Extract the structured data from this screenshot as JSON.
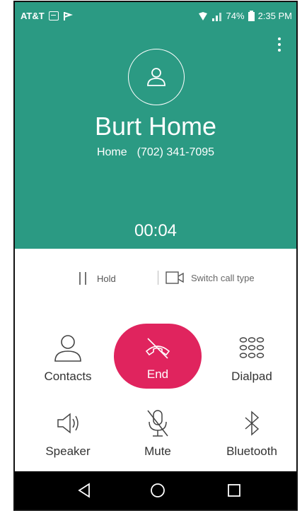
{
  "status_bar": {
    "carrier": "AT&T",
    "battery": "74%",
    "time": "2:35 PM"
  },
  "call": {
    "name": "Burt Home",
    "label": "Home",
    "number": "(702) 341-7095",
    "timer": "00:04"
  },
  "options": {
    "hold_label": "Hold",
    "switch_label": "Switch call type"
  },
  "buttons": {
    "contacts": "Contacts",
    "end": "End",
    "dialpad": "Dialpad",
    "speaker": "Speaker",
    "mute": "Mute",
    "bluetooth": "Bluetooth"
  },
  "colors": {
    "header": "#2b9a83",
    "end_button": "#e0245e",
    "navbar": "#000000"
  },
  "icons": [
    "avatar-icon",
    "hold-icon",
    "video-call-icon",
    "contacts-icon",
    "end-call-icon",
    "dialpad-icon",
    "speaker-icon",
    "mute-icon",
    "bluetooth-icon",
    "back-icon",
    "home-icon",
    "recents-icon"
  ]
}
